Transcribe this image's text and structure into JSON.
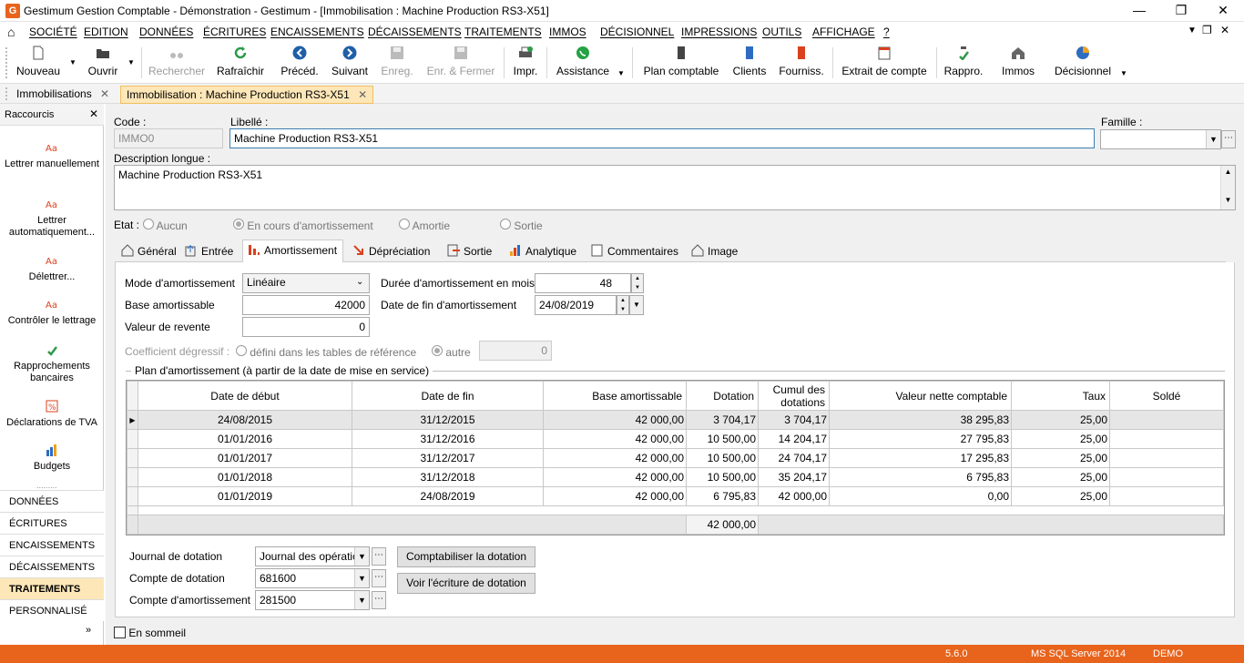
{
  "window": {
    "title": "Gestimum Gestion Comptable - Démonstration - Gestimum - [Immobilisation : Machine Production RS3-X51]",
    "app_icon": "G"
  },
  "menu": [
    "SOCIÉTÉ",
    "EDITION",
    "DONNÉES",
    "ÉCRITURES",
    "ENCAISSEMENTS",
    "DÉCAISSEMENTS",
    "TRAITEMENTS",
    "IMMOS",
    "DÉCISIONNEL",
    "IMPRESSIONS",
    "OUTILS",
    "AFFICHAGE",
    "?"
  ],
  "toolbar": {
    "nouveau": "Nouveau",
    "ouvrir": "Ouvrir",
    "rechercher": "Rechercher",
    "rafraichir": "Rafraîchir",
    "preced": "Précéd.",
    "suivant": "Suivant",
    "enreg": "Enreg.",
    "enr_fermer": "Enr. & Fermer",
    "impr": "Impr.",
    "assistance": "Assistance",
    "plan_comptable": "Plan comptable",
    "clients": "Clients",
    "fourniss": "Fourniss.",
    "extrait": "Extrait de compte",
    "rappro": "Rappro.",
    "immos": "Immos",
    "decisionnel": "Décisionnel"
  },
  "doc_tabs": [
    "Immobilisations",
    "Immobilisation : Machine Production RS3-X51"
  ],
  "sidebar": {
    "title": "Raccourcis",
    "items": [
      "Lettrer manuellement",
      "Lettrer automatiquement...",
      "Délettrer...",
      "Contrôler le lettrage",
      "Rapprochements bancaires",
      "Déclarations de TVA",
      "Budgets"
    ],
    "categories": [
      "DONNÉES",
      "ÉCRITURES",
      "ENCAISSEMENTS",
      "DÉCAISSEMENTS",
      "TRAITEMENTS",
      "PERSONNALISÉ"
    ]
  },
  "form": {
    "code_label": "Code :",
    "code_value": "IMMO0",
    "libelle_label": "Libellé :",
    "libelle_value": "Machine Production RS3-X51",
    "famille_label": "Famille :",
    "famille_value": "",
    "desc_label": "Description longue :",
    "desc_value": "Machine Production RS3-X51",
    "etat_label": "Etat :",
    "etat_options": [
      "Aucun",
      "En cours d'amortissement",
      "Amortie",
      "Sortie"
    ]
  },
  "tabs": [
    "Général",
    "Entrée",
    "Amortissement",
    "Dépréciation",
    "Sortie",
    "Analytique",
    "Commentaires",
    "Image"
  ],
  "amort": {
    "mode_label": "Mode d'amortissement",
    "mode_value": "Linéaire",
    "base_label": "Base amortissable",
    "base_value": "42000",
    "revente_label": "Valeur de revente",
    "revente_value": "0",
    "duree_label": "Durée d'amortissement en mois",
    "duree_value": "48",
    "fin_label": "Date de fin d'amortissement",
    "fin_value": "24/08/2019",
    "coef_label": "Coefficient dégressif :",
    "coef_opt1": "défini dans les tables de référence",
    "coef_opt2": "autre",
    "coef_value": "0",
    "plan_label": "Plan d'amortissement (à partir de la date de mise en service)"
  },
  "plan": {
    "columns": [
      "Date de début",
      "Date de fin",
      "Base amortissable",
      "Dotation",
      "Cumul des dotations",
      "Valeur nette comptable",
      "Taux",
      "Soldé"
    ],
    "rows": [
      [
        "24/08/2015",
        "31/12/2015",
        "42 000,00",
        "3 704,17",
        "3 704,17",
        "38 295,83",
        "25,00",
        ""
      ],
      [
        "01/01/2016",
        "31/12/2016",
        "42 000,00",
        "10 500,00",
        "14 204,17",
        "27 795,83",
        "25,00",
        ""
      ],
      [
        "01/01/2017",
        "31/12/2017",
        "42 000,00",
        "10 500,00",
        "24 704,17",
        "17 295,83",
        "25,00",
        ""
      ],
      [
        "01/01/2018",
        "31/12/2018",
        "42 000,00",
        "10 500,00",
        "35 204,17",
        "6 795,83",
        "25,00",
        ""
      ],
      [
        "01/01/2019",
        "24/08/2019",
        "42 000,00",
        "6 795,83",
        "42 000,00",
        "0,00",
        "25,00",
        ""
      ]
    ],
    "total_dotation": "42 000,00"
  },
  "journal": {
    "journal_label": "Journal de dotation",
    "journal_value": "Journal des opératio",
    "compte_dot_label": "Compte de dotation",
    "compte_dot_value": "681600",
    "compte_amort_label": "Compte d'amortissement",
    "compte_amort_value": "281500",
    "btn_compta": "Comptabiliser la dotation",
    "btn_voir": "Voir l'écriture de dotation"
  },
  "sommeil_label": "En sommeil",
  "status": {
    "version": "5.6.0",
    "server": "MS SQL Server 2014",
    "mode": "DEMO"
  },
  "colors": {
    "accent": "#e8631b",
    "active_tab": "#fde7b8"
  }
}
